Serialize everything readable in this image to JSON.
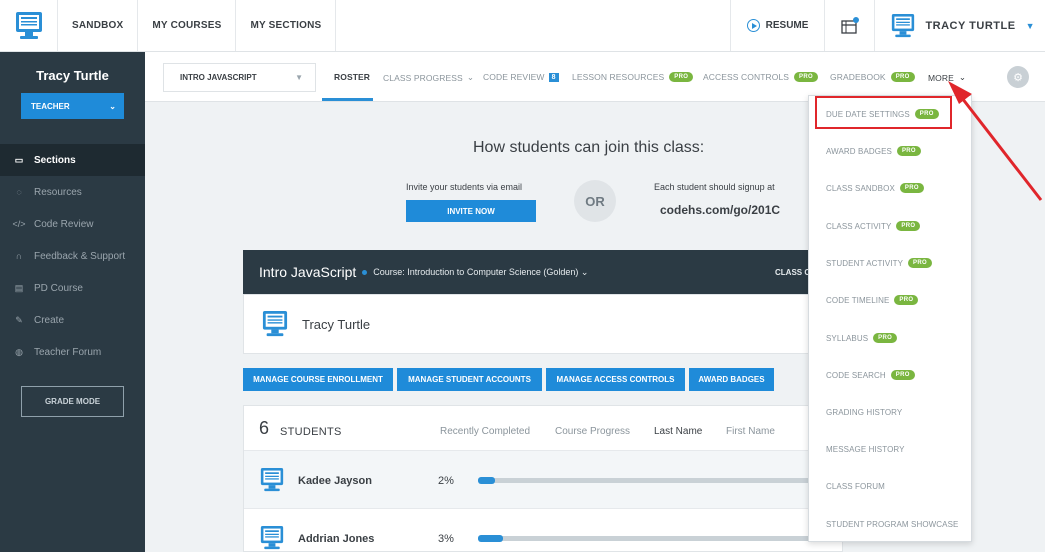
{
  "topnav": {
    "links": [
      "SANDBOX",
      "MY COURSES",
      "MY SECTIONS"
    ],
    "resume": "RESUME",
    "user": "TRACY TURTLE"
  },
  "sidebar": {
    "name": "Tracy Turtle",
    "role": "TEACHER",
    "items": [
      {
        "label": "Sections",
        "icon": "monitor-icon"
      },
      {
        "label": "Resources",
        "icon": "lightbulb-icon"
      },
      {
        "label": "Code Review",
        "icon": "code-icon"
      },
      {
        "label": "Feedback & Support",
        "icon": "headset-icon"
      },
      {
        "label": "PD Course",
        "icon": "certificate-icon"
      },
      {
        "label": "Create",
        "icon": "pencil-icon"
      },
      {
        "label": "Teacher Forum",
        "icon": "chat-icon"
      }
    ],
    "grade_mode": "GRADE MODE"
  },
  "subnav": {
    "class_select": "INTRO JAVASCRIPT",
    "tabs": {
      "roster": "ROSTER",
      "class_progress": "CLASS PROGRESS",
      "code_review": "CODE REVIEW",
      "code_review_count": "8",
      "lesson_resources": "LESSON RESOURCES",
      "access_controls": "ACCESS CONTROLS",
      "gradebook": "GRADEBOOK",
      "more": "MORE"
    },
    "pro": "PRO"
  },
  "join": {
    "title": "How students can join this class:",
    "invite_text": "Invite your students via email",
    "invite_button": "INVITE NOW",
    "or": "OR",
    "signup_text": "Each student should signup at",
    "signup_url": "codehs.com/go/201C"
  },
  "course": {
    "name": "Intro JavaScript",
    "subtitle": "Course: Introduction to Computer Science (Golden) ⌄",
    "right_label": "CLASS C"
  },
  "teacher_card": {
    "name": "Tracy Turtle"
  },
  "actions": [
    "MANAGE COURSE ENROLLMENT",
    "MANAGE STUDENT ACCOUNTS",
    "MANAGE ACCESS CONTROLS",
    "AWARD BADGES"
  ],
  "students": {
    "count": "6",
    "label": "STUDENTS",
    "columns": [
      "Recently Completed",
      "Course Progress",
      "Last Name",
      "First Name"
    ],
    "rows": [
      {
        "name": "Kadee Jayson",
        "progress": "2%",
        "fraction": 0.02
      },
      {
        "name": "Addrian Jones",
        "progress": "3%",
        "fraction": 0.03
      }
    ]
  },
  "more_menu": [
    {
      "label": "DUE DATE SETTINGS",
      "pro": true
    },
    {
      "label": "AWARD BADGES",
      "pro": true
    },
    {
      "label": "CLASS SANDBOX",
      "pro": true
    },
    {
      "label": "CLASS ACTIVITY",
      "pro": true
    },
    {
      "label": "STUDENT ACTIVITY",
      "pro": true
    },
    {
      "label": "CODE TIMELINE",
      "pro": true
    },
    {
      "label": "SYLLABUS",
      "pro": true
    },
    {
      "label": "CODE SEARCH",
      "pro": true
    },
    {
      "label": "GRADING HISTORY",
      "pro": false
    },
    {
      "label": "MESSAGE HISTORY",
      "pro": false
    },
    {
      "label": "CLASS FORUM",
      "pro": false
    },
    {
      "label": "STUDENT PROGRAM SHOWCASE",
      "pro": false
    }
  ],
  "colors": {
    "accent": "#1f8bd9",
    "sidebar": "#2b3a44",
    "pro": "#7ab640",
    "annotation": "#e0262b"
  }
}
